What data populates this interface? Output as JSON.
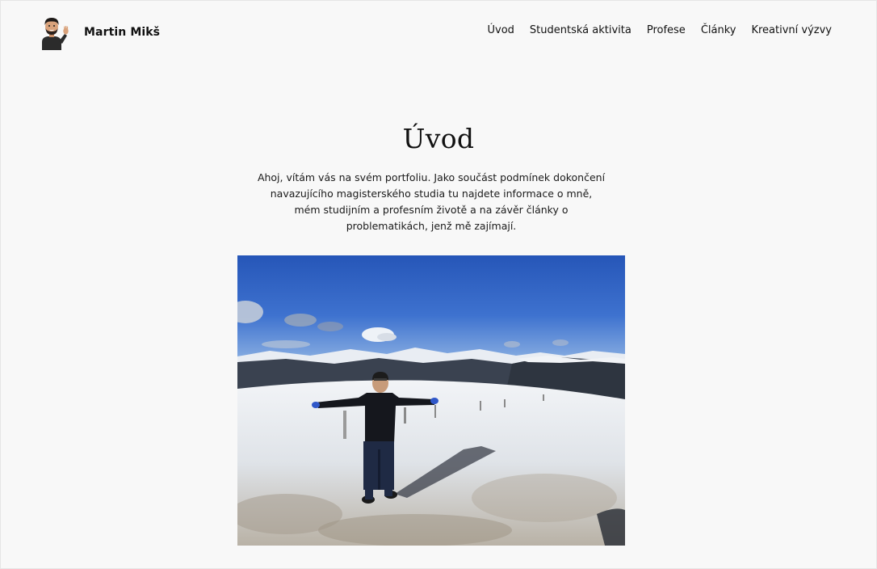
{
  "site": {
    "name": "Martin Mikš",
    "avatar_icon": "memoji-waving-avatar-icon"
  },
  "nav": {
    "items": [
      {
        "label": "Úvod"
      },
      {
        "label": "Studentská aktivita"
      },
      {
        "label": "Profese"
      },
      {
        "label": "Články"
      },
      {
        "label": "Kreativní výzvy"
      }
    ]
  },
  "main": {
    "title": "Úvod",
    "intro": "Ahoj, vítám vás na svém portfoliu. Jako součást podmínek dokončení navazujícího magisterského studia tu najdete informace o mně, mém studijním a profesním životě a na závěr články o problematikách, jenž mě zajímají.",
    "hero_image": "photo-man-on-snowy-mountain"
  },
  "colors": {
    "background": "#f8f8f8",
    "text": "#111111"
  }
}
